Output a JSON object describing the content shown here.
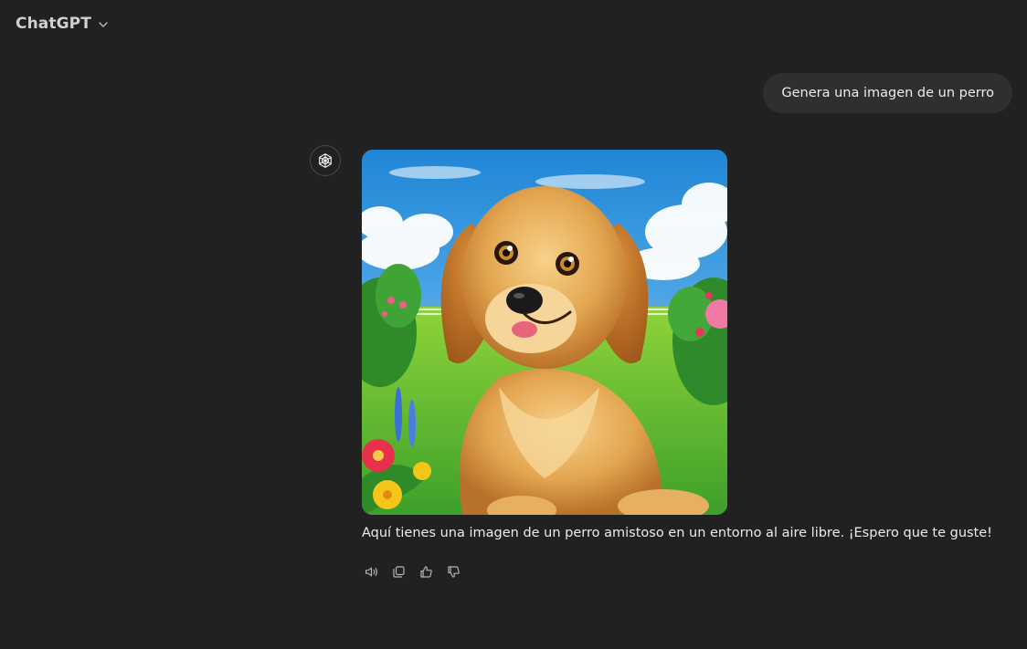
{
  "header": {
    "title": "ChatGPT",
    "dropdown_icon": "chevron-down-icon"
  },
  "conversation": {
    "user_message": "Genera una imagen de un perro",
    "assistant": {
      "avatar_icon": "openai-logo-icon",
      "image_subject": "golden-retriever-puppy-illustration",
      "reply_text": "Aquí tienes una imagen de un perro amistoso en un entorno al aire libre. ¡Espero que te guste!",
      "actions": [
        {
          "icon": "speaker-icon"
        },
        {
          "icon": "copy-icon"
        },
        {
          "icon": "thumbs-up-icon"
        },
        {
          "icon": "thumbs-down-icon"
        }
      ]
    }
  },
  "colors": {
    "background": "#212121",
    "user_bubble": "#2f2f2f",
    "text": "#ececec",
    "muted_icon": "#b4b4b4"
  }
}
